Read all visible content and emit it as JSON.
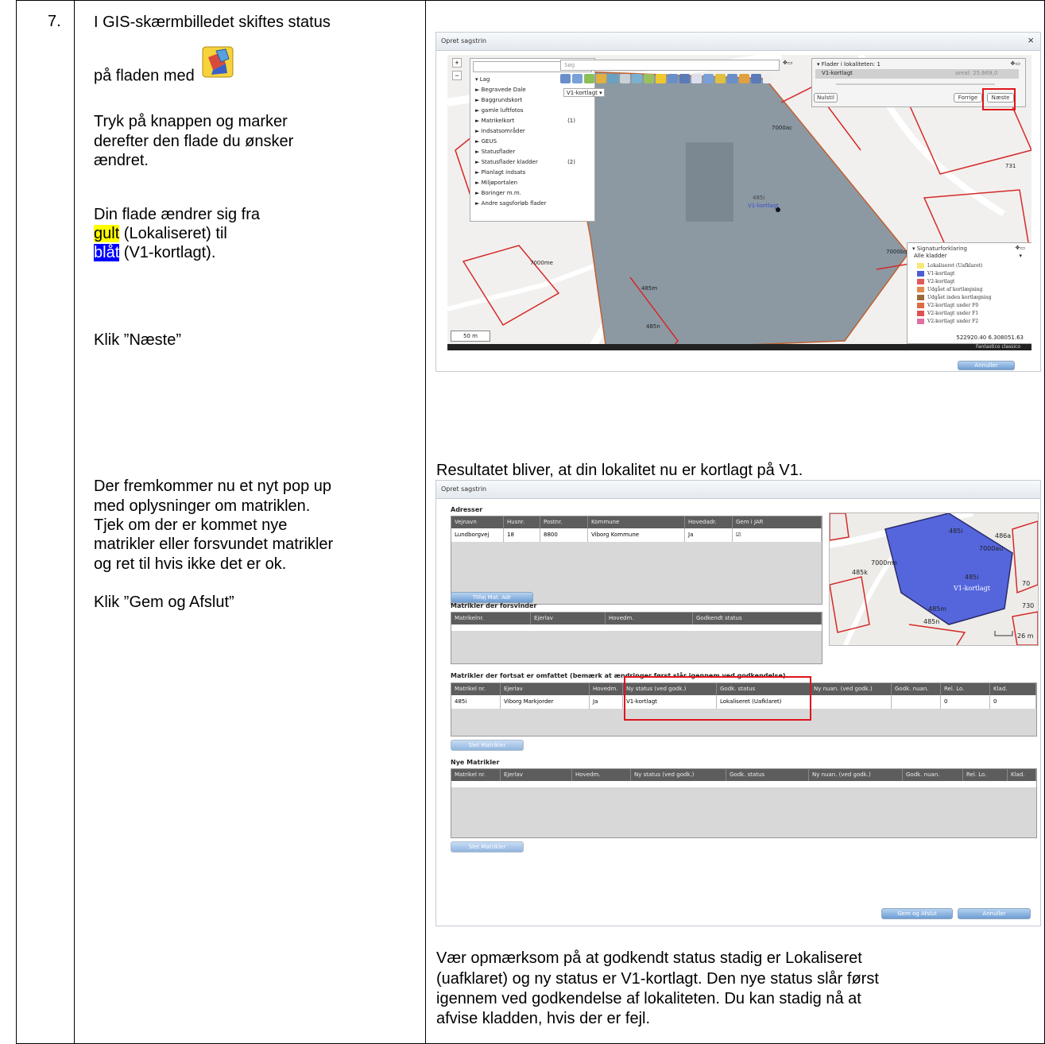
{
  "step": {
    "number": "7.",
    "intro_line1": "I GIS-skærmbilledet skiftes status",
    "intro_line2": "på fladen med",
    "instruction1_line1": "Tryk på knappen og marker",
    "instruction1_line2": "derefter den flade du ønsker",
    "instruction1_line3": "ændret.",
    "change_line1": "Din flade ændrer sig fra",
    "yellow_word": "gult",
    "yellow_rest": " (Lokaliseret) til",
    "blue_word": "blåt",
    "blue_rest": " (V1-kortlagt).",
    "click_next": "Klik ”Næste”",
    "popup_line1": "Der fremkommer nu et nyt pop up",
    "popup_line2": "med oplysninger om matriklen.",
    "popup_line3": "Tjek om der er kommet nye",
    "popup_line4": "matrikler eller forsvundet matrikler",
    "popup_line5": "og ret til hvis ikke det er ok.",
    "click_save": "Klik ”Gem og Afslut”",
    "result_text": "Resultatet bliver, at din lokalitet nu er kortlagt på V1.",
    "note_line1": "Vær opmærksom på at godkendt status stadig er Lokaliseret",
    "note_line2": "(uafklaret) og ny status er V1-kortlagt. Den nye status slår først",
    "note_line3": "igennem ved godkendelse af lokaliteten. Du kan stadig nå at",
    "note_line4": "afvise kladden, hvis der er fejl."
  },
  "gis_window": {
    "title": "Opret sagstrin",
    "search_placeholder": "Søg",
    "layer_select": "V1-kortlagt ▾",
    "layers_header": "▾ Lag",
    "layers": [
      {
        "label": "► Begravede Dale",
        "count": ""
      },
      {
        "label": "► Baggrundskort",
        "count": ""
      },
      {
        "label": "► gamle luftfotos",
        "count": ""
      },
      {
        "label": "► Matrikelkort",
        "count": "(1)"
      },
      {
        "label": "► Indsatsområder",
        "count": ""
      },
      {
        "label": "► GEUS",
        "count": ""
      },
      {
        "label": "► Statusflader",
        "count": ""
      },
      {
        "label": "► Statusflader kladder",
        "count": "(2)"
      },
      {
        "label": "► Planlagt indsats",
        "count": ""
      },
      {
        "label": "► Miljøportalen",
        "count": ""
      },
      {
        "label": "► Boringer m.m.",
        "count": ""
      },
      {
        "label": "► Andre sagsforløb flader",
        "count": ""
      }
    ],
    "flader_header": "▾ Flader i lokaliteten: 1",
    "flader_name": "V1-kortlagt",
    "flader_area": "areal: 25.669,0",
    "btn_nulstil": "Nulstil",
    "btn_forrige": "Forrige",
    "btn_naeste": "Næste",
    "parcel_label": "485i",
    "parcel_sublabel": "V1-kortlagt",
    "map_labels": [
      "7000ac",
      "731",
      "7000bq",
      "7000me",
      "485m",
      "485n"
    ],
    "legend_header": "▾ Signaturforklaring",
    "legend_sub": "Alle kladder",
    "legend_items": [
      {
        "label": "Lokaliseret (Uafklaret)",
        "color": "#f5e97a"
      },
      {
        "label": "V1-kortlagt",
        "color": "#4b5ed6"
      },
      {
        "label": "V2-kortlagt",
        "color": "#e05a5a"
      },
      {
        "label": "Udgået af kortlægning",
        "color": "#e08a50"
      },
      {
        "label": "Udgået inden kortlægning",
        "color": "#9b6a3a"
      },
      {
        "label": "V2-kortlagt under F0",
        "color": "#e06a40"
      },
      {
        "label": "V2-kortlagt under F1",
        "color": "#e05050"
      },
      {
        "label": "V2-kortlagt under F2",
        "color": "#e070a0"
      }
    ],
    "coords": "522920.40 6.308051.63",
    "basemap": "Fantastico classico",
    "scale": "50 m",
    "btn_annuller": "Annuller"
  },
  "form_window": {
    "title": "Opret sagstrin",
    "adresser_title": "Adresser",
    "addr_headers": [
      "Vejnavn",
      "Husnr.",
      "Postnr.",
      "Kommune",
      "Hovedadr.",
      "Gem i JAR"
    ],
    "addr_row": [
      "Lundborgvej",
      "18",
      "8800",
      "Viborg Kommune",
      "Ja",
      "☑"
    ],
    "btn_tilfoej": "Tilføj Mat. Adr",
    "forsvinder_title": "Matrikler der forsvinder",
    "forsvinder_headers": [
      "Matrikelnr.",
      "Ejerlav",
      "Hovedm.",
      "Godkendt status"
    ],
    "fortsat_title": "Matrikler der fortsat er omfattet (bemærk at ændringer først slår igennem ved godkendelse)",
    "fortsat_headers": [
      "Matrikel nr.",
      "Ejerlav",
      "Hovedm.",
      "Ny status (ved godk.)",
      "Godk. status",
      "Ny nuan. (ved godk.)",
      "Godk. nuan.",
      "Rel. Lo.",
      "Klad."
    ],
    "fortsat_row": [
      "485i",
      "Viborg Markjorder",
      "Ja",
      "V1-kortlagt",
      "Lokaliseret (Uafklaret)",
      "",
      "",
      "0",
      "0"
    ],
    "btn_slet1": "Slet Matrikler",
    "nye_title": "Nye Matrikler",
    "nye_headers": [
      "Matrikel nr.",
      "Ejerlav",
      "Hovedm.",
      "Ny status (ved godk.)",
      "Godk. status",
      "Ny nuan. (ved godk.)",
      "Godk. nuan.",
      "Rel. Lo.",
      "Klad."
    ],
    "btn_slet2": "Slet Matrikler",
    "btn_gem": "Gem og Afslut",
    "btn_annuller": "Annuller",
    "mini_labels": [
      "485k",
      "485i",
      "486a",
      "7000au",
      "7000me",
      "485i",
      "V1-kortlagt",
      "485m",
      "485n",
      "730",
      "70",
      "26 m"
    ]
  }
}
